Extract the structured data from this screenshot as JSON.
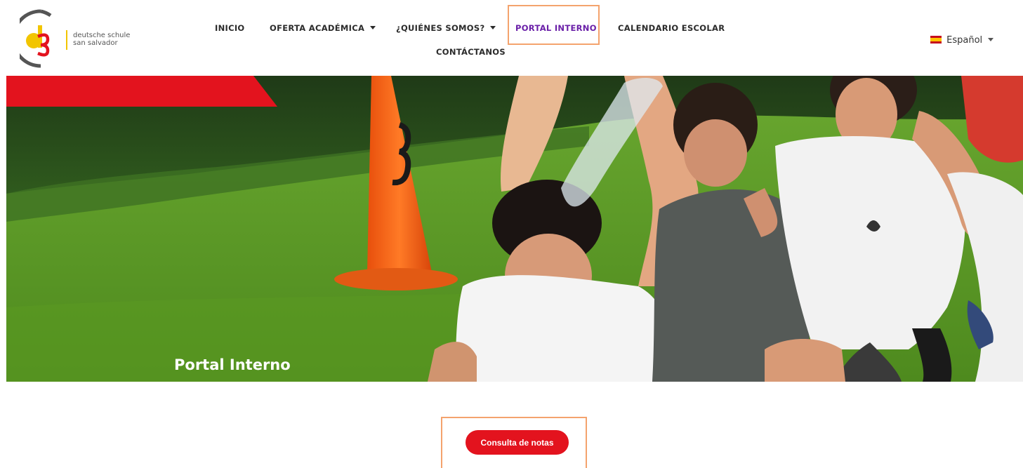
{
  "brand": {
    "logo_letters": "ds",
    "line1": "deutsche schule",
    "line2": "san salvador"
  },
  "nav": {
    "items": [
      {
        "label": "INICIO",
        "dropdown": false,
        "active": false
      },
      {
        "label": "OFERTA ACADÉMICA",
        "dropdown": true,
        "active": false
      },
      {
        "label": "¿QUIÉNES SOMOS?",
        "dropdown": true,
        "active": false
      },
      {
        "label": "PORTAL INTERNO",
        "dropdown": false,
        "active": true
      },
      {
        "label": "CALENDARIO ESCOLAR",
        "dropdown": false,
        "active": false
      },
      {
        "label": "CONTÁCTANOS",
        "dropdown": false,
        "active": false
      }
    ]
  },
  "language": {
    "selected": "Español",
    "flag_icon": "spain-flag-icon"
  },
  "hero": {
    "title": "Portal Interno",
    "cone_number": "3"
  },
  "main": {
    "cta_label": "Consulta de notas"
  },
  "colors": {
    "accent_red": "#e3131e",
    "active_nav": "#6a1fa8",
    "highlight_outline": "#f4a36d",
    "logo_yellow": "#f2c500"
  }
}
